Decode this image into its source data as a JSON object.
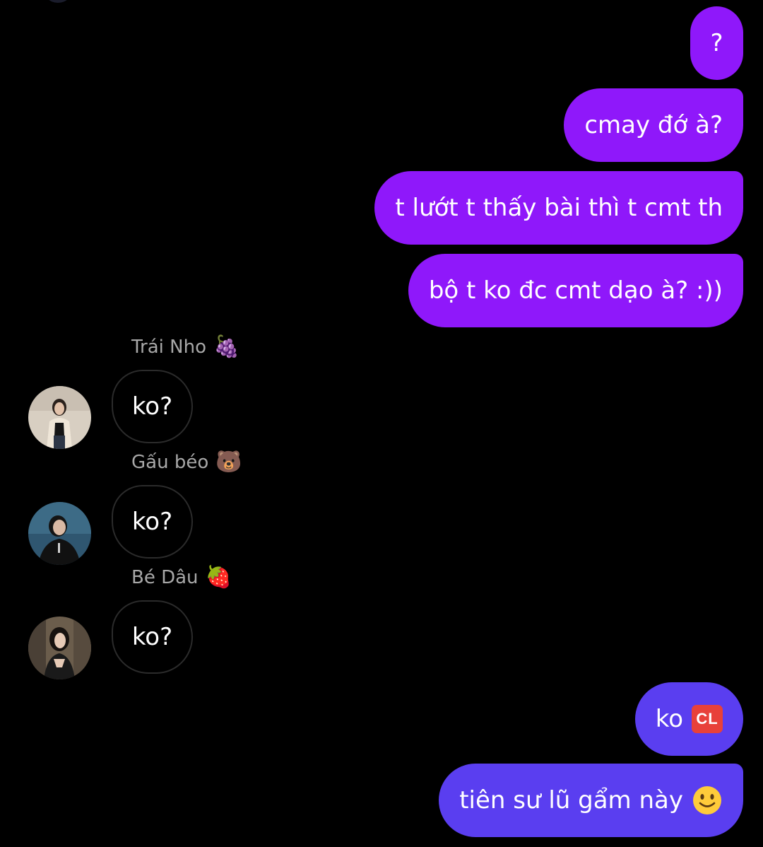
{
  "outgoing_top": [
    {
      "text": "?"
    },
    {
      "text": "cmay đớ à?"
    },
    {
      "text": "t lướt t thấy bài thì t cmt th"
    },
    {
      "text": "bộ t ko đc cmt dạo à? :))"
    }
  ],
  "incoming": [
    {
      "sender": "Trái Nho",
      "sender_emoji": "🍇",
      "text": "ko?"
    },
    {
      "sender": "Gấu béo",
      "sender_emoji": "🐻",
      "text": "ko?"
    },
    {
      "sender": "Bé Dâu",
      "sender_emoji": "🍓",
      "text": "ko?"
    }
  ],
  "outgoing_bottom": [
    {
      "text": "ko",
      "badge": "CL"
    },
    {
      "text": "tiên sư lũ gẩm này",
      "icon": "slightly-smiling-face-icon"
    }
  ],
  "colors": {
    "background": "#000000",
    "outgoing_purple": "#8f18fa",
    "outgoing_indigo": "#5a3ef0",
    "incoming_border": "#2b2b2b",
    "sender_name": "#a8a8a8",
    "cl_badge": "#e8413a"
  }
}
